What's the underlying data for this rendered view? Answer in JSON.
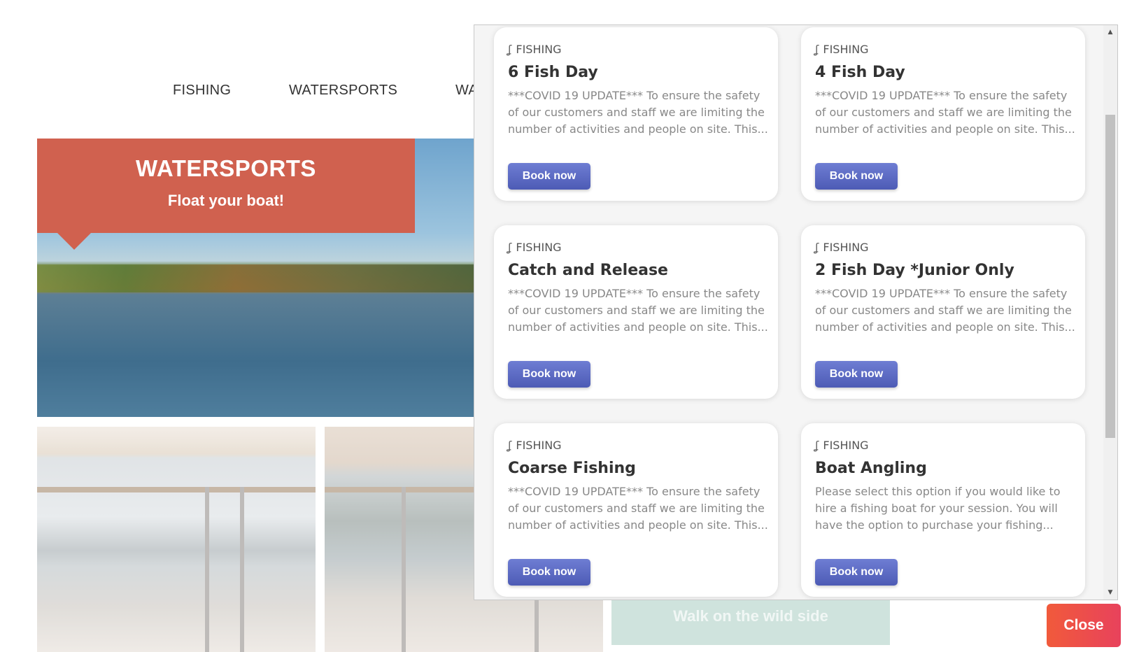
{
  "nav": {
    "items": [
      "FISHING",
      "WATERSPORTS",
      "WA"
    ]
  },
  "hero": {
    "title": "WATERSPORTS",
    "subtitle": "Float your boat!"
  },
  "wild_tile": {
    "label": "Walk on the wild side"
  },
  "modal": {
    "cards": [
      {
        "category": "FISHING",
        "title": "6 Fish Day",
        "description": "***COVID 19 UPDATE*** To ensure the safety of our customers and staff we are limiting the number of activities and people on site. This...",
        "button": "Book now"
      },
      {
        "category": "FISHING",
        "title": "4 Fish Day",
        "description": "***COVID 19 UPDATE*** To ensure the safety of our customers and staff we are limiting the number of activities and people on site. This...",
        "button": "Book now"
      },
      {
        "category": "FISHING",
        "title": "Catch and Release",
        "description": "***COVID 19 UPDATE*** To ensure the safety of our customers and staff we are limiting the number of activities and people on site. This...",
        "button": "Book now"
      },
      {
        "category": "FISHING",
        "title": "2 Fish Day *Junior Only",
        "description": "***COVID 19 UPDATE*** To ensure the safety of our customers and staff we are limiting the number of activities and people on site. This...",
        "button": "Book now"
      },
      {
        "category": "FISHING",
        "title": "Coarse Fishing",
        "description": "***COVID 19 UPDATE*** To ensure the safety of our customers and staff we are limiting the number of activities and people on site. This...",
        "button": "Book now"
      },
      {
        "category": "FISHING",
        "title": "Boat Angling",
        "description": "Please select this option if you would like to hire a fishing boat for your session. You will have the option to purchase your fishing...",
        "button": "Book now"
      }
    ]
  },
  "close_button": "Close",
  "icons": {
    "category": "fishing-hook-icon",
    "scroll_up": "arrow-up-icon",
    "scroll_down": "arrow-down-icon"
  },
  "colors": {
    "banner": "#d0614f",
    "book_button": "#5563c1",
    "close_button": "#eb4a4f",
    "wild_tile": "#cfe3dd"
  }
}
